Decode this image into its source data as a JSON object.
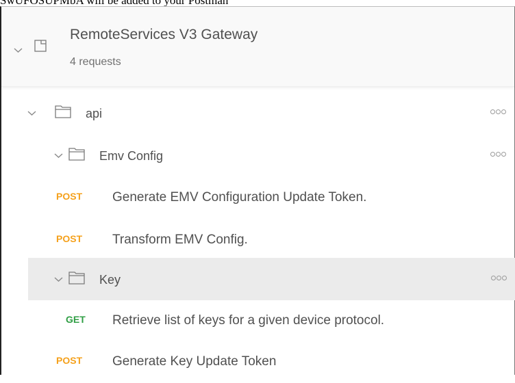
{
  "caption": "SwUFOSUPMbA will be added to your Postman",
  "collection": {
    "title": "RemoteServices V3 Gateway",
    "count": "4 requests"
  },
  "folders": {
    "api": "api",
    "emv_config": "Emv Config",
    "key": "Key"
  },
  "requests": [
    {
      "method": "POST",
      "label": "Generate EMV Configuration Update Token."
    },
    {
      "method": "POST",
      "label": "Transform EMV Config."
    },
    {
      "method": "GET",
      "label": "Retrieve list of keys for a given device protocol."
    },
    {
      "method": "POST",
      "label": "Generate Key Update Token"
    }
  ],
  "colors": {
    "post": "#f5a11c",
    "get": "#2f9e44",
    "selected_row": "#ebebeb",
    "text": "#505050"
  },
  "icons": {
    "chevron": "chevron-down-icon",
    "folder": "folder-icon",
    "collection": "collection-icon",
    "more": "more-options-icon"
  }
}
